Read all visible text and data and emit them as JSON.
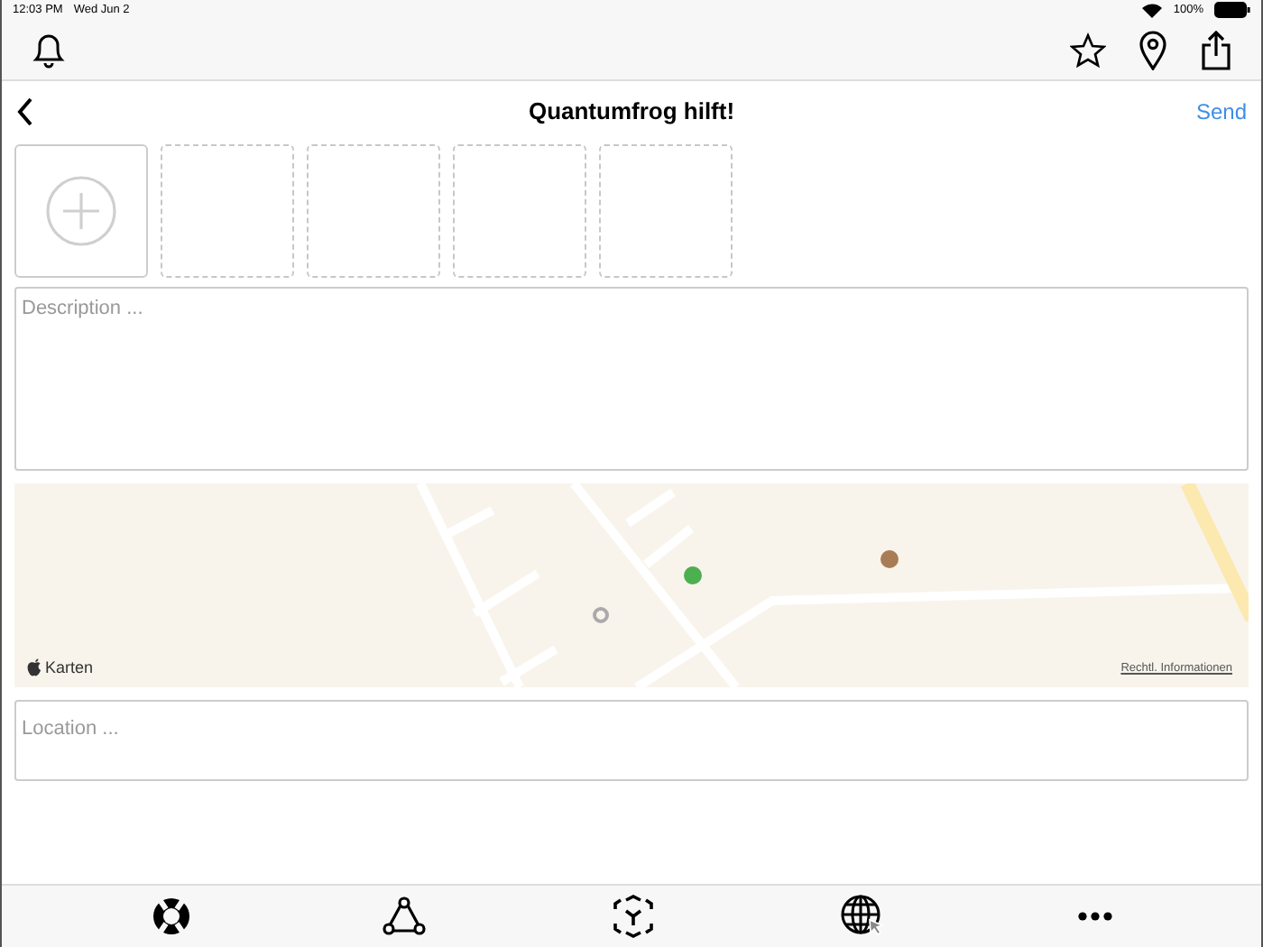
{
  "status_bar": {
    "time": "12:03 PM",
    "date": "Wed Jun 2",
    "battery": "100%"
  },
  "navigation": {
    "title": "Quantumfrog hilft!",
    "action": "Send"
  },
  "photo_slots": [
    {
      "kind": "add"
    },
    {
      "kind": "empty"
    },
    {
      "kind": "empty"
    },
    {
      "kind": "empty"
    },
    {
      "kind": "empty"
    }
  ],
  "description": {
    "placeholder": "Description ..."
  },
  "map": {
    "brand": "Karten",
    "legal_link": "Rechtl. Informationen"
  },
  "location": {
    "placeholder": "Location ..."
  }
}
